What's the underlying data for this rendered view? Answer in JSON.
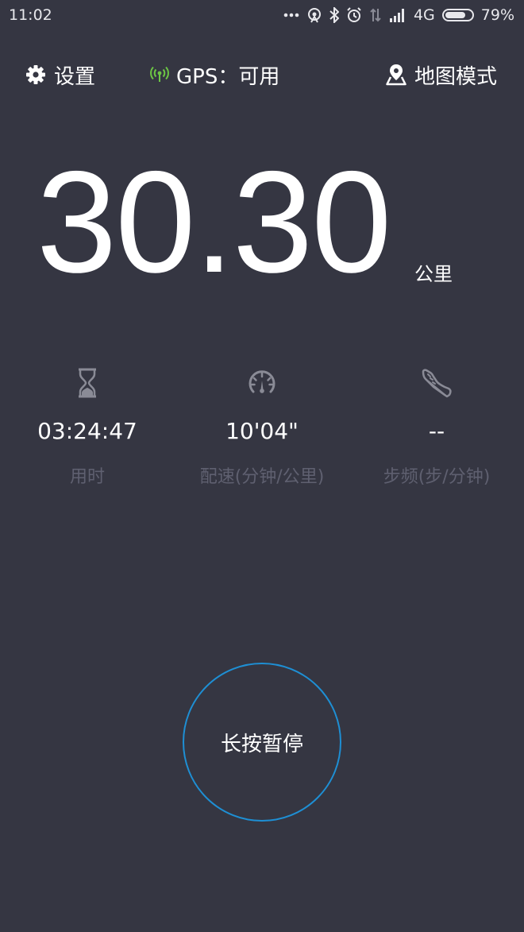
{
  "status_bar": {
    "time": "11:02",
    "network": "4G",
    "battery_percent": "79%",
    "battery_level": 0.79
  },
  "top_bar": {
    "settings_label": "设置",
    "gps_label": "GPS：可用",
    "map_mode_label": "地图模式"
  },
  "distance": {
    "value": "30.30",
    "unit": "公里"
  },
  "stats": {
    "time": {
      "value": "03:24:47",
      "label": "用时",
      "icon": "hourglass-icon"
    },
    "pace": {
      "value": "10'04\"",
      "label": "配速(分钟/公里)",
      "icon": "speedometer-icon"
    },
    "cadence": {
      "value": "--",
      "label": "步频(步/分钟)",
      "icon": "shoe-icon"
    }
  },
  "pause_button": {
    "label": "长按暂停"
  },
  "colors": {
    "background": "#353642",
    "accent_ring": "#1e8fd4",
    "gps_ok": "#6cc644",
    "muted_label": "#5f6070",
    "icon_gray": "#8a8b96"
  }
}
